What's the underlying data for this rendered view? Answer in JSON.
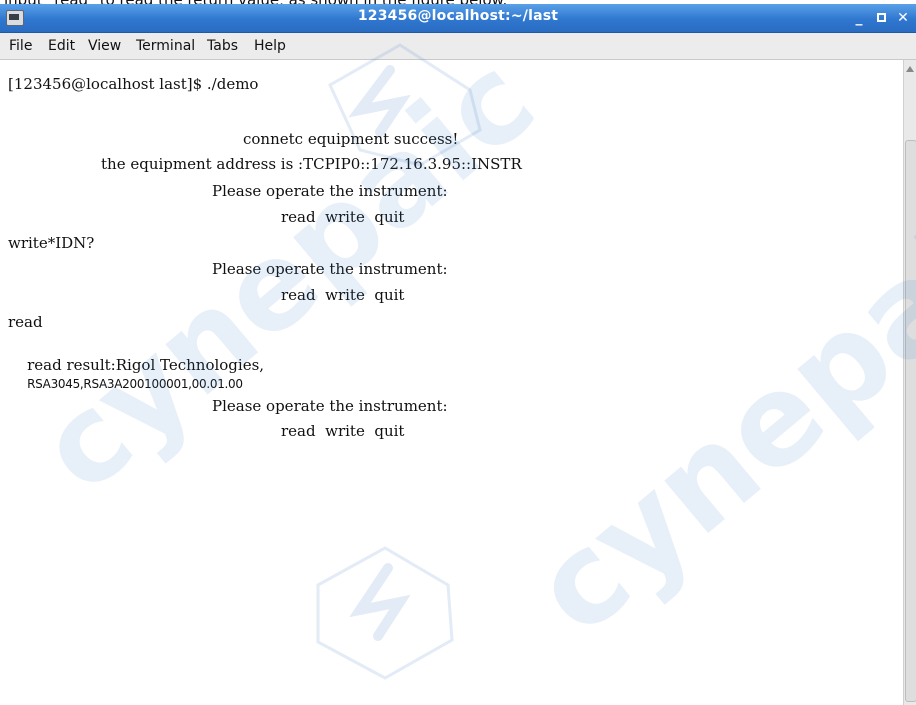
{
  "caption": "input \"read\" to read the return value, as shown in the figure below.",
  "window": {
    "title": "123456@localhost:~/last",
    "minimize": "_",
    "close": "✕"
  },
  "menu": [
    "File",
    "Edit",
    "View",
    "Terminal",
    "Tabs",
    "Help"
  ],
  "terminal_lines": [
    "[123456@localhost last]$ ./demo",
    "connetc equipment success!",
    "the equipment address is :TCPIP0::172.16.3.95::INSTR",
    "Please operate the instrument:",
    "read  write  quit",
    "write*IDN?",
    "Please operate the instrument:",
    "read  write  quit",
    "read",
    "read result:Rigol Technologies,",
    "RSA3045,RSA3A200100001,00.01.00",
    "Please operate the instrument:",
    "read  write  quit"
  ],
  "watermark": {
    "text": "cynepaic",
    "color": "#3a78c9"
  }
}
